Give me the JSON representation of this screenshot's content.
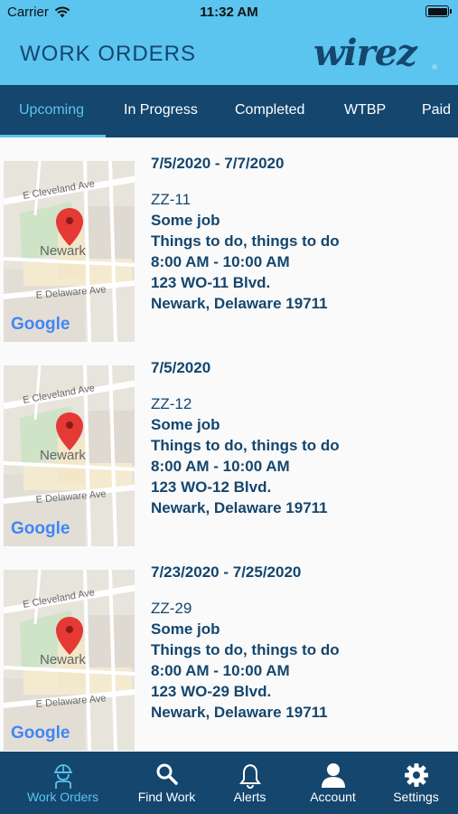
{
  "status_bar": {
    "carrier": "Carrier",
    "time": "11:32 AM"
  },
  "header": {
    "title": "WORK ORDERS",
    "logo_text": "wirez"
  },
  "tabs": [
    {
      "label": "Upcoming",
      "active": true
    },
    {
      "label": "In Progress",
      "active": false
    },
    {
      "label": "Completed",
      "active": false
    },
    {
      "label": "WTBP",
      "active": false
    },
    {
      "label": "Paid",
      "active": false
    }
  ],
  "map": {
    "street_top": "E Cleveland Ave",
    "city": "Newark",
    "street_bottom": "E Delaware Ave",
    "attribution": "Google"
  },
  "work_orders": [
    {
      "dates": "7/5/2020 - 7/7/2020",
      "code": "ZZ-11",
      "name": "Some job",
      "description": "Things to do, things to do",
      "time": "8:00 AM - 10:00 AM",
      "address1": "123 WO-11 Blvd.",
      "address2": "Newark, Delaware 19711"
    },
    {
      "dates": "7/5/2020",
      "code": "ZZ-12",
      "name": "Some job",
      "description": "Things to do, things to do",
      "time": "8:00 AM - 10:00 AM",
      "address1": "123 WO-12 Blvd.",
      "address2": "Newark, Delaware 19711"
    },
    {
      "dates": "7/23/2020 - 7/25/2020",
      "code": "ZZ-29",
      "name": "Some job",
      "description": "Things to do, things to do",
      "time": "8:00 AM - 10:00 AM",
      "address1": "123 WO-29 Blvd.",
      "address2": "Newark, Delaware 19711"
    }
  ],
  "bottom_nav": [
    {
      "label": "Work Orders",
      "icon": "hard-hat-worker-icon",
      "active": true
    },
    {
      "label": "Find Work",
      "icon": "search-icon",
      "active": false
    },
    {
      "label": "Alerts",
      "icon": "bell-icon",
      "active": false
    },
    {
      "label": "Account",
      "icon": "person-icon",
      "active": false
    },
    {
      "label": "Settings",
      "icon": "gear-icon",
      "active": false
    }
  ],
  "colors": {
    "header_bg": "#5bc4ef",
    "nav_bg": "#14466e",
    "accent": "#5bc4ef",
    "text_primary": "#14466e",
    "pin": "#e53935"
  }
}
